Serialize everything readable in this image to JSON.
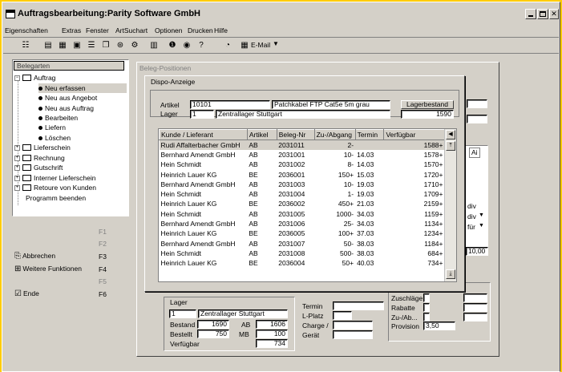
{
  "window": {
    "title": "Auftragsbearbeitung:Parity Software GmbH"
  },
  "menu": [
    "Eigenschaften",
    "Extras",
    "Fenster",
    "ArtSuchart",
    "Optionen",
    "Drucken",
    "Hilfe"
  ],
  "toolbar": {
    "email_label": "E-Mail"
  },
  "nav": {
    "header": "Belegarten",
    "auftrag": "Auftrag",
    "auftrag_items": [
      "Neu erfassen",
      "Neu aus Angebot",
      "Neu aus Auftrag",
      "Bearbeiten",
      "Liefern",
      "Löschen"
    ],
    "folders": [
      "Lieferschein",
      "Rechnung",
      "Gutschrift",
      "Interner Lieferschein",
      "Retoure von Kunden"
    ],
    "end_item": "Programm beenden"
  },
  "fkeys": [
    {
      "label": "",
      "key": "F1"
    },
    {
      "label": "",
      "key": "F2"
    },
    {
      "label": "Abbrechen",
      "key": "F3"
    },
    {
      "label": "Weitere Funktionen",
      "key": "F4"
    },
    {
      "label": "",
      "key": "F5"
    },
    {
      "label": "Ende",
      "key": "F6"
    }
  ],
  "beleg": {
    "title": "Beleg-Positionen",
    "right_values": [
      "div",
      "div",
      "für",
      "10,00"
    ],
    "right_header": "Ai",
    "lager_group": "Lager",
    "lager_nr": "1",
    "lager_name": "Zentrallager Stuttgart",
    "bestand_label": "Bestand",
    "bestand": "1690",
    "ab_label": "AB",
    "ab": "1606",
    "bestellt_label": "Bestellt",
    "bestellt": "750",
    "mb_label": "MB",
    "mb": "100",
    "verfuegbar_label": "Verfügbar",
    "verfuegbar": "734",
    "mid_labels": [
      "Termin",
      "L-Platz",
      "Charge /",
      "Gerät"
    ],
    "right_labels": [
      "Zuschläge",
      "Rabatte",
      "Zu-/Ab...",
      "Provision"
    ],
    "provision": "3,50"
  },
  "dispo": {
    "title": "Dispo-Anzeige",
    "artikel_label": "Artikel",
    "artikel_nr": "10101",
    "artikel_name": "Patchkabel FTP Cat5e 5m grau",
    "lager_label": "Lager",
    "lager_nr": "1",
    "lager_name": "Zentrallager Stuttgart",
    "lagerbestand_label": "Lagerbestand",
    "lagerbestand": "1590",
    "columns": [
      "Kunde / Lieferant",
      "Artikel",
      "Beleg-Nr",
      "Zu-/Abgang",
      "Termin",
      "Verfügbar"
    ],
    "rows": [
      [
        "Rudi Affalterbacher GmbH",
        "AB",
        "2031011",
        "2-",
        "",
        "1588+"
      ],
      [
        "Bernhard Amendt GmbH",
        "AB",
        "2031001",
        "10-",
        "14.03",
        "1578+"
      ],
      [
        "Hein Schmidt",
        "AB",
        "2031002",
        "8-",
        "14.03",
        "1570+"
      ],
      [
        "Heinrich Lauer KG",
        "BE",
        "2036001",
        "150+",
        "15.03",
        "1720+"
      ],
      [
        "Bernhard Amendt GmbH",
        "AB",
        "2031003",
        "10-",
        "19.03",
        "1710+"
      ],
      [
        "Hein Schmidt",
        "AB",
        "2031004",
        "1-",
        "19.03",
        "1709+"
      ],
      [
        "Heinrich Lauer KG",
        "BE",
        "2036002",
        "450+",
        "21.03",
        "2159+"
      ],
      [
        "Hein Schmidt",
        "AB",
        "2031005",
        "1000-",
        "34.03",
        "1159+"
      ],
      [
        "Bernhard Amendt GmbH",
        "AB",
        "2031006",
        "25-",
        "34.03",
        "1134+"
      ],
      [
        "Heinrich Lauer KG",
        "BE",
        "2036005",
        "100+",
        "37.03",
        "1234+"
      ],
      [
        "Bernhard Amendt GmbH",
        "AB",
        "2031007",
        "50-",
        "38.03",
        "1184+"
      ],
      [
        "Hein Schmidt",
        "AB",
        "2031008",
        "500-",
        "38.03",
        "684+"
      ],
      [
        "Heinrich Lauer KG",
        "BE",
        "2036004",
        "50+",
        "40.03",
        "734+"
      ]
    ]
  },
  "colors": {
    "desktop": "#ffcc00",
    "title_bar": "#d4d0c8",
    "selection": "#d4d0c8"
  }
}
